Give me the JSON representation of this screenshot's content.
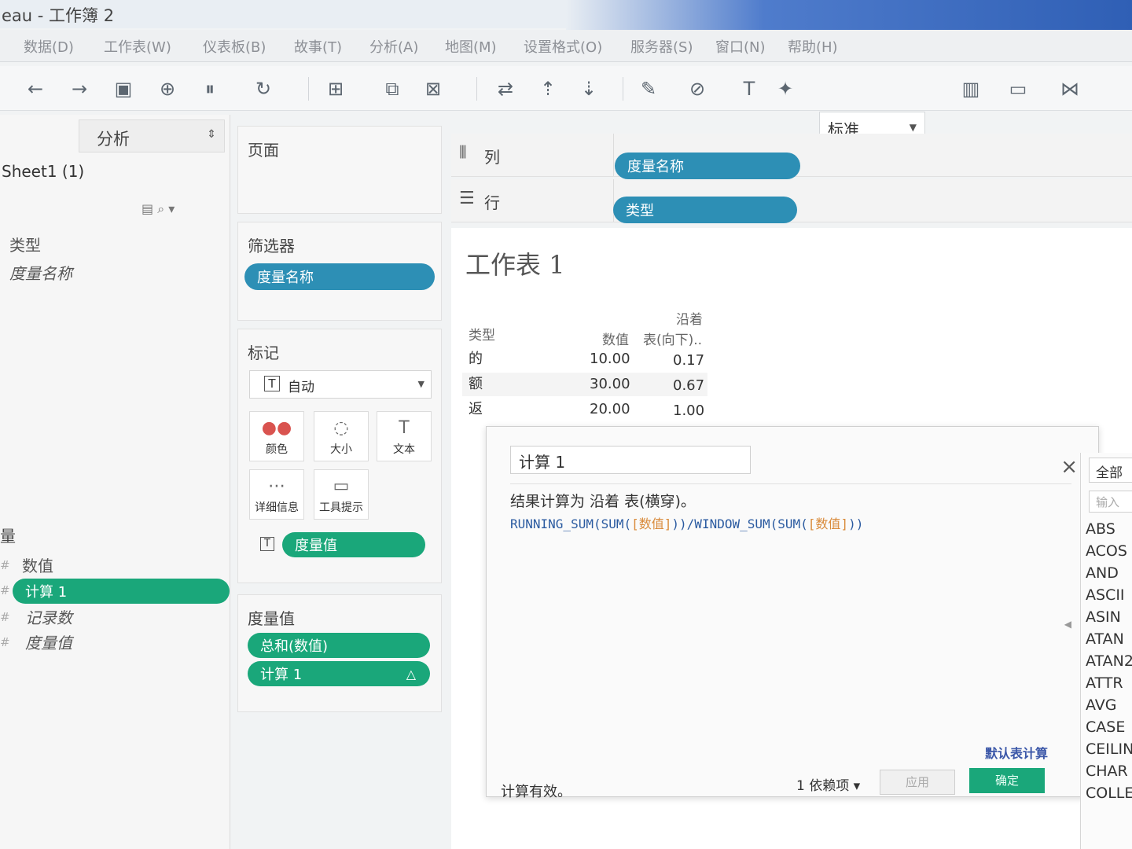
{
  "window": {
    "title": "eau - 工作簿 2"
  },
  "menu": [
    "数据(D)",
    "工作表(W)",
    "仪表板(B)",
    "故事(T)",
    "分析(A)",
    "地图(M)",
    "设置格式(O)",
    "服务器(S)",
    "窗口(N)",
    "帮助(H)"
  ],
  "toolbar": {
    "standard_select": "标准"
  },
  "left_panel": {
    "tab_label": "分析",
    "data_source": "Sheet1 (1)",
    "dimensions": [
      "类型",
      "度量名称"
    ],
    "measures_header": "量",
    "measures": [
      "数值",
      "计算 1",
      "记录数",
      "度量值"
    ]
  },
  "pages_card": {
    "title": "页面"
  },
  "filters_card": {
    "title": "筛选器",
    "pill": "度量名称"
  },
  "marks_card": {
    "title": "标记",
    "type": "自动",
    "buttons": [
      "颜色",
      "大小",
      "文本",
      "详细信息",
      "工具提示"
    ],
    "pill": "度量值"
  },
  "measure_values_card": {
    "title": "度量值",
    "pills": [
      "总和(数值)",
      "计算 1"
    ],
    "delta_icon": "△"
  },
  "shelves": {
    "columns": {
      "label": "列",
      "pill": "度量名称"
    },
    "rows": {
      "label": "行",
      "pill": "类型"
    }
  },
  "view": {
    "title": "工作表 1",
    "table": {
      "row_header": "类型",
      "col1_header": "数值",
      "col2_header_line1": "沿着",
      "col2_header_line2": "表(向下)..",
      "rows": [
        {
          "type": "的",
          "value": "10.00",
          "calc": "0.17"
        },
        {
          "type": "额",
          "value": "30.00",
          "calc": "0.67"
        },
        {
          "type": "返",
          "value": "20.00",
          "calc": "1.00"
        }
      ]
    }
  },
  "calc_dialog": {
    "name": "计算 1",
    "result_line": "结果计算为 沿着 表(横穿)。",
    "formula_parts": [
      "RUNNING_SUM(SUM(",
      "[数值]",
      "))/WINDOW_SUM(SUM(",
      "[数值]",
      "))"
    ],
    "default_table_calc": "默认表计算",
    "status": "计算有效。",
    "dependencies": "1 依赖项 ▾",
    "apply": "应用",
    "ok": "确定",
    "close": "×"
  },
  "function_panel": {
    "header": "全部",
    "search_placeholder": "输入",
    "functions": [
      "ABS",
      "ACOS",
      "AND",
      "ASCII",
      "ASIN",
      "ATAN",
      "ATAN2",
      "ATTR",
      "AVG",
      "CASE",
      "CEILING",
      "CHAR",
      "COLLECT"
    ]
  }
}
